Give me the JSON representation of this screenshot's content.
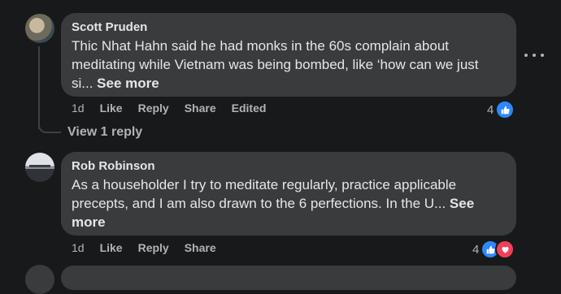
{
  "comments": [
    {
      "author": "Scott Pruden",
      "text_line1": "Thic Nhat Hahn said he had monks in the 60s complain about",
      "text_line2": "meditating while Vietnam was being bombed, like ‘how can we just",
      "text_line3": "si... ",
      "see_more": "See more",
      "timestamp": "1d",
      "like": "Like",
      "reply": "Reply",
      "share": "Share",
      "edited": "Edited",
      "reaction_count": "4",
      "reactions": [
        "like-icon"
      ]
    },
    {
      "author": "Rob Robinson",
      "text_line1": "As a householder I try to meditate regularly, practice applicable",
      "text_line2": "precepts, and I am also drawn to the 6 perfections. In the U... ",
      "see_more_a": "See",
      "see_more_b": "more",
      "timestamp": "1d",
      "like": "Like",
      "reply": "Reply",
      "share": "Share",
      "reaction_count": "4",
      "reactions": [
        "like-icon",
        "love-icon"
      ]
    }
  ],
  "view_replies": "View 1 reply",
  "colors": {
    "background": "#18191a",
    "bubble": "#3a3b3c",
    "like": "#2d88ff",
    "love": "#f33e58"
  }
}
